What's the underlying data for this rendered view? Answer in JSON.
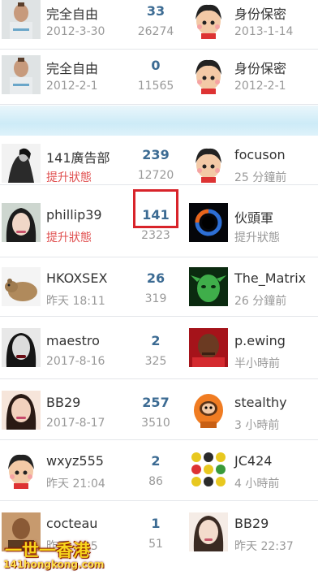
{
  "rows": [
    {
      "left_name": "完全自由",
      "left_sub": "2012-3-30",
      "count": "33",
      "views": "26274",
      "right_name": "身份保密",
      "right_sub": "2013-1-14"
    },
    {
      "left_name": "完全自由",
      "left_sub": "2012-2-1",
      "count": "0",
      "views": "11565",
      "right_name": "身份保密",
      "right_sub": "2012-2-1"
    },
    {
      "left_name": "141廣告部",
      "left_sub": "提升狀態",
      "count": "239",
      "views": "12720",
      "right_name": "focuson",
      "right_sub": "25 分鐘前"
    },
    {
      "left_name": "phillip39",
      "left_sub": "提升狀態",
      "count": "141",
      "views": "2323",
      "right_name": "伙頭軍",
      "right_sub": "提升狀態"
    },
    {
      "left_name": "HKOXSEX",
      "left_sub": "昨天 18:11",
      "count": "26",
      "views": "319",
      "right_name": "The_Matrix",
      "right_sub": "26 分鐘前"
    },
    {
      "left_name": "maestro",
      "left_sub": "2017-8-16",
      "count": "2",
      "views": "325",
      "right_name": "p.ewing",
      "right_sub": "半小時前"
    },
    {
      "left_name": "BB29",
      "left_sub": "2017-8-17",
      "count": "257",
      "views": "3510",
      "right_name": "stealthy",
      "right_sub": "3 小時前"
    },
    {
      "left_name": "wxyz555",
      "left_sub": "昨天 21:04",
      "count": "2",
      "views": "86",
      "right_name": "JC424",
      "right_sub": "4 小時前"
    },
    {
      "left_name": "cocteau",
      "left_sub": "昨天 ...25",
      "count": "1",
      "views": "51",
      "right_name": "BB29",
      "right_sub": "昨天 22:37"
    }
  ],
  "watermark": {
    "title": "一世一香港",
    "url": "141hongkong.com"
  }
}
